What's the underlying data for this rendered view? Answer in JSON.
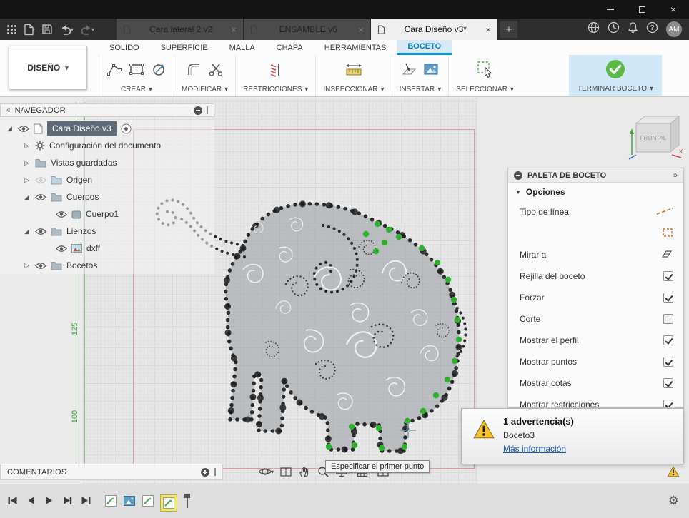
{
  "glyphs": {
    "caret_down": "▾",
    "triangle_down": "▼",
    "triangle_right": "▷",
    "triangle_open": "◢",
    "chevrons_left": "«",
    "chevrons_right": "»",
    "close": "×",
    "plus": "+",
    "gear": "⚙"
  },
  "tabbar": {
    "tabs": [
      {
        "label": "Cara lateral 2 v2",
        "active": false
      },
      {
        "label": "ENSAMBLE v6",
        "active": false
      },
      {
        "label": "Cara Diseño v3*",
        "active": true
      }
    ],
    "new_tab": "+",
    "avatar": "AM"
  },
  "ribbon": {
    "workspace_button": "DISEÑO",
    "categories": [
      {
        "label": "SOLIDO",
        "active": false
      },
      {
        "label": "SUPERFICIE",
        "active": false
      },
      {
        "label": "MALLA",
        "active": false
      },
      {
        "label": "CHAPA",
        "active": false
      },
      {
        "label": "HERRAMIENTAS",
        "active": false
      },
      {
        "label": "BOCETO",
        "active": true
      }
    ],
    "groups": [
      {
        "label": "CREAR"
      },
      {
        "label": "MODIFICAR"
      },
      {
        "label": "RESTRICCIONES"
      },
      {
        "label": "INSPECCIONAR"
      },
      {
        "label": "INSERTAR"
      },
      {
        "label": "SELECCIONAR"
      }
    ],
    "finish_button": "TERMINAR BOCETO"
  },
  "navigator": {
    "title": "NAVEGADOR",
    "items": [
      {
        "label": "Cara Diseño v3",
        "selected": true
      },
      {
        "label": "Configuración del documento",
        "selected": false
      },
      {
        "label": "Vistas guardadas",
        "selected": false
      },
      {
        "label": "Origen",
        "selected": false
      },
      {
        "label": "Cuerpos",
        "selected": false
      },
      {
        "label": "Cuerpo1",
        "selected": false
      },
      {
        "label": "Lienzos",
        "selected": false
      },
      {
        "label": "dxff",
        "selected": false
      },
      {
        "label": "Bocetos",
        "selected": false
      }
    ]
  },
  "viewcube": {
    "face": "FRONTAL",
    "axis_x": "X"
  },
  "canvas": {
    "dim_labels": [
      "125",
      "100"
    ],
    "tooltip": "Especificar el primer punto"
  },
  "palette": {
    "title": "PALETA DE BOCETO",
    "section": "Opciones",
    "rows": [
      {
        "label": "Tipo de línea",
        "control": "icon",
        "checked": null
      },
      {
        "label": "",
        "control": "icon",
        "checked": null
      },
      {
        "label": "Mirar a",
        "control": "icon",
        "checked": null
      },
      {
        "label": "Rejilla del boceto",
        "control": "checkbox",
        "checked": true
      },
      {
        "label": "Forzar",
        "control": "checkbox",
        "checked": true
      },
      {
        "label": "Corte",
        "control": "checkbox",
        "checked": false
      },
      {
        "label": "Mostrar el perfil",
        "control": "checkbox",
        "checked": true
      },
      {
        "label": "Mostrar puntos",
        "control": "checkbox",
        "checked": true
      },
      {
        "label": "Mostrar cotas",
        "control": "checkbox",
        "checked": true
      },
      {
        "label": "Mostrar restricciones",
        "control": "checkbox",
        "checked": true
      }
    ]
  },
  "warning_panel": {
    "title": "1 advertencia(s)",
    "item": "Boceto3",
    "link": "Más información"
  },
  "comments": {
    "title": "COMENTARIOS"
  },
  "colors": {
    "accent_blue": "#0696d7",
    "active_category_bg": "#d7e9f6",
    "finish_green": "#5cb947",
    "warning_yellow": "#f7c331",
    "selected_row": "#5f6b76",
    "sketch_point_green": "#2fb02f",
    "canvas_boundary_red": "#e09a9a",
    "dimension_green": "#3f9f3f"
  }
}
